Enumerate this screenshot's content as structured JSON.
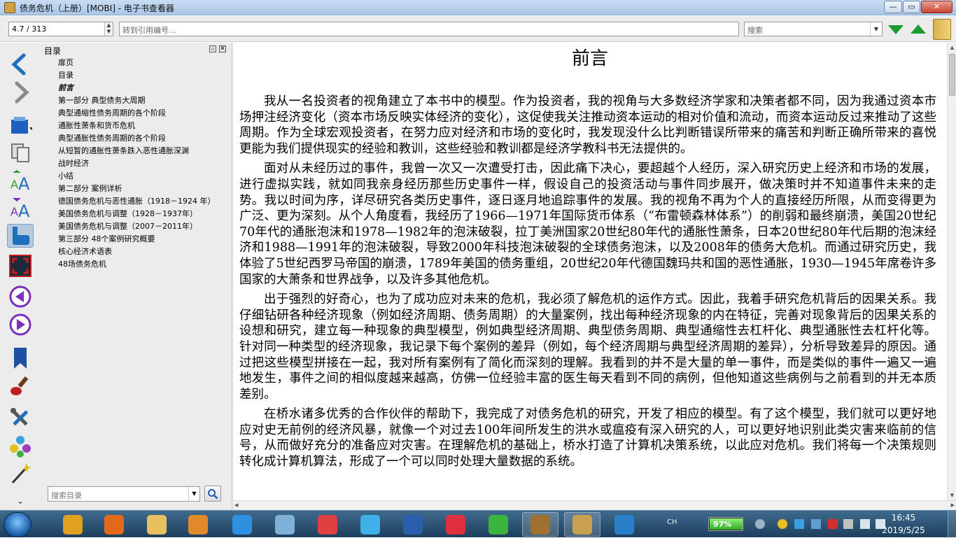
{
  "window": {
    "title": "债务危机（上册）[MOBI] - 电子书查看器",
    "minimize_label": "—",
    "maximize_label": "▭",
    "close_label": "✕"
  },
  "toolbar": {
    "page_value": "4.7 / 313",
    "page_spin_up": "▲",
    "page_spin_down": "▼",
    "goto_placeholder": "转到引用编号…",
    "search_placeholder": "搜索",
    "dropdown_glyph": "▼",
    "find_next_color": "#1a9c2e",
    "find_prev_color": "#1a9c2e"
  },
  "sidebar": {
    "buttons": [
      {
        "name": "back-icon",
        "color": "#1f6fbf"
      },
      {
        "name": "forward-icon",
        "color": "#8a8a8a"
      },
      {
        "name": "open-book-icon",
        "color": "#1f5fbf"
      },
      {
        "name": "copy-icon",
        "color": "#777777"
      },
      {
        "name": "font-larger-icon",
        "color": "#1f6fbf"
      },
      {
        "name": "font-smaller-icon",
        "color": "#7a2fbf"
      },
      {
        "name": "select-mode-icon",
        "color": "#1f6fbf",
        "active": true
      },
      {
        "name": "fullscreen-icon",
        "color": "#c02020"
      },
      {
        "name": "previous-page-icon",
        "color": "#7a2fbf"
      },
      {
        "name": "next-page-icon",
        "color": "#7a2fbf"
      },
      {
        "name": "bookmark-icon",
        "color": "#1f4fa0"
      },
      {
        "name": "theme-brush-icon",
        "color": "#c02020"
      },
      {
        "name": "preferences-icon",
        "color": "#555555"
      },
      {
        "name": "plugins-icon",
        "color": "#3a7fbf"
      },
      {
        "name": "magic-wand-icon",
        "color": "#333333"
      }
    ],
    "more_glyph": "⌄"
  },
  "toc": {
    "header": "目录",
    "float_glyph": "▫",
    "close_glyph": "✕",
    "items": [
      {
        "label": "扉页"
      },
      {
        "label": "目录"
      },
      {
        "label": "前言",
        "current": true
      },
      {
        "label": "第一部分 典型债务大周期"
      },
      {
        "label": "典型通缩性债务周期的各个阶段"
      },
      {
        "label": "通胀性萧条和货币危机"
      },
      {
        "label": "典型通胀性债务周期的各个阶段"
      },
      {
        "label": "从短暂的通胀性萧条跌入恶性通胀深渊"
      },
      {
        "label": "战时经济"
      },
      {
        "label": "小结"
      },
      {
        "label": "第二部分 案例详析"
      },
      {
        "label": "德国债务危机与恶性通胀（1918－1924 年）"
      },
      {
        "label": "美国债务危机与调整（1928－1937年）"
      },
      {
        "label": "美国债务危机与调整（2007－2011年）"
      },
      {
        "label": "第三部分 48个案例研究概要"
      },
      {
        "label": "核心经济术语表"
      },
      {
        "label": "48场债务危机"
      }
    ],
    "search_placeholder": "搜索目录"
  },
  "content": {
    "chapter_title": "前言",
    "paragraphs": [
      "我从一名投资者的视角建立了本书中的模型。作为投资者，我的视角与大多数经济学家和决策者都不同，因为我通过资本市场押注经济变化（资本市场反映实体经济的变化），这促使我关注推动资本运动的相对价值和流动，而资本运动反过来推动了这些周期。作为全球宏观投资者，在努力应对经济和市场的变化时，我发现没什么比判断错误所带来的痛苦和判断正确所带来的喜悦更能为我们提供现实的经验和教训，这些经验和教训都是经济学教科书无法提供的。",
      "面对从未经历过的事件，我曾一次又一次遭受打击，因此痛下决心，要超越个人经历，深入研究历史上经济和市场的发展，进行虚拟实践，就如同我亲身经历那些历史事件一样，假设自己的投资活动与事件同步展开，做决策时并不知道事件未来的走势。我以时间为序，详尽研究各类历史事件，逐日逐月地追踪事件的发展。我的视角不再为个人的直接经历所限，从而变得更为广泛、更为深刻。从个人角度看，我经历了1966—1971年国际货币体系（“布雷顿森林体系”）的削弱和最终崩溃，美国20世纪70年代的通胀泡沫和1978—1982年的泡沫破裂，拉丁美洲国家20世纪80年代的通胀性萧条，日本20世纪80年代后期的泡沫经济和1988—1991年的泡沫破裂，导致2000年科技泡沫破裂的全球债务泡沫，以及2008年的债务大危机。而通过研究历史，我体验了5世纪西罗马帝国的崩溃，1789年美国的债务重组，20世纪20年代德国魏玛共和国的恶性通胀，1930—1945年席卷许多国家的大萧条和世界战争，以及许多其他危机。",
      "出于强烈的好奇心，也为了成功应对未来的危机，我必须了解危机的运作方式。因此，我着手研究危机背后的因果关系。我仔细钻研各种经济现象（例如经济周期、债务周期）的大量案例，找出每种经济现象的内在特征，完善对现象背后的因果关系的设想和研究，建立每一种现象的典型模型，例如典型经济周期、典型债务周期、典型通缩性去杠杆化、典型通胀性去杠杆化等。针对同一种类型的经济现象，我记录下每个案例的差异（例如，每个经济周期与典型经济周期的差异），分析导致差异的原因。通过把这些模型拼接在一起，我对所有案例有了简化而深刻的理解。我看到的并不是大量的单一事件，而是类似的事件一遍又一遍地发生，事件之间的相似度越来越高，仿佛一位经验丰富的医生每天看到不同的病例，但他知道这些病例与之前看到的并无本质差别。",
      "在桥水诸多优秀的合作伙伴的帮助下，我完成了对债务危机的研究，开发了相应的模型。有了这个模型，我们就可以更好地应对史无前例的经济风暴，就像一个对过去100年间所发生的洪水或瘟疫有深入研究的人，可以更好地识别此类灾害来临前的信号，从而做好充分的准备应对灾害。在理解危机的基础上，桥水打造了计算机决策系统，以此应对危机。我们将每一个决策规则转化成计算机算法，形成了一个可以同时处理大量数据的系统。"
    ],
    "scroll_up": "▲",
    "scroll_down": "▼",
    "scroll_left": "◀",
    "scroll_right": "▶"
  },
  "taskbar": {
    "apps": [
      {
        "name": "chrome-icon",
        "color": "#e0a020"
      },
      {
        "name": "firefox-icon",
        "color": "#e06a1a"
      },
      {
        "name": "file-explorer-icon",
        "color": "#e8c060"
      },
      {
        "name": "video-player-icon",
        "color": "#e08a2a"
      },
      {
        "name": "wps-icon",
        "color": "#2f8fe0"
      },
      {
        "name": "notes-icon",
        "color": "#7fb0d8"
      },
      {
        "name": "pdf-icon",
        "color": "#e04040"
      },
      {
        "name": "cloud-drive-icon",
        "color": "#3fb0e8"
      },
      {
        "name": "word-icon",
        "color": "#2b5fad"
      },
      {
        "name": "media-player-icon",
        "color": "#e03040"
      },
      {
        "name": "iqiyi-icon",
        "color": "#3cb43c"
      },
      {
        "name": "calibre-library-icon",
        "color": "#a07030",
        "active": true
      },
      {
        "name": "ebook-viewer-icon",
        "color": "#c8a050",
        "active": true
      },
      {
        "name": "browser-icon",
        "color": "#2a7fc8"
      }
    ],
    "ime_label": "CH",
    "battery_percent": "97%",
    "battery_level": 0.97,
    "time": "16:45",
    "date": "2019/5/25"
  }
}
